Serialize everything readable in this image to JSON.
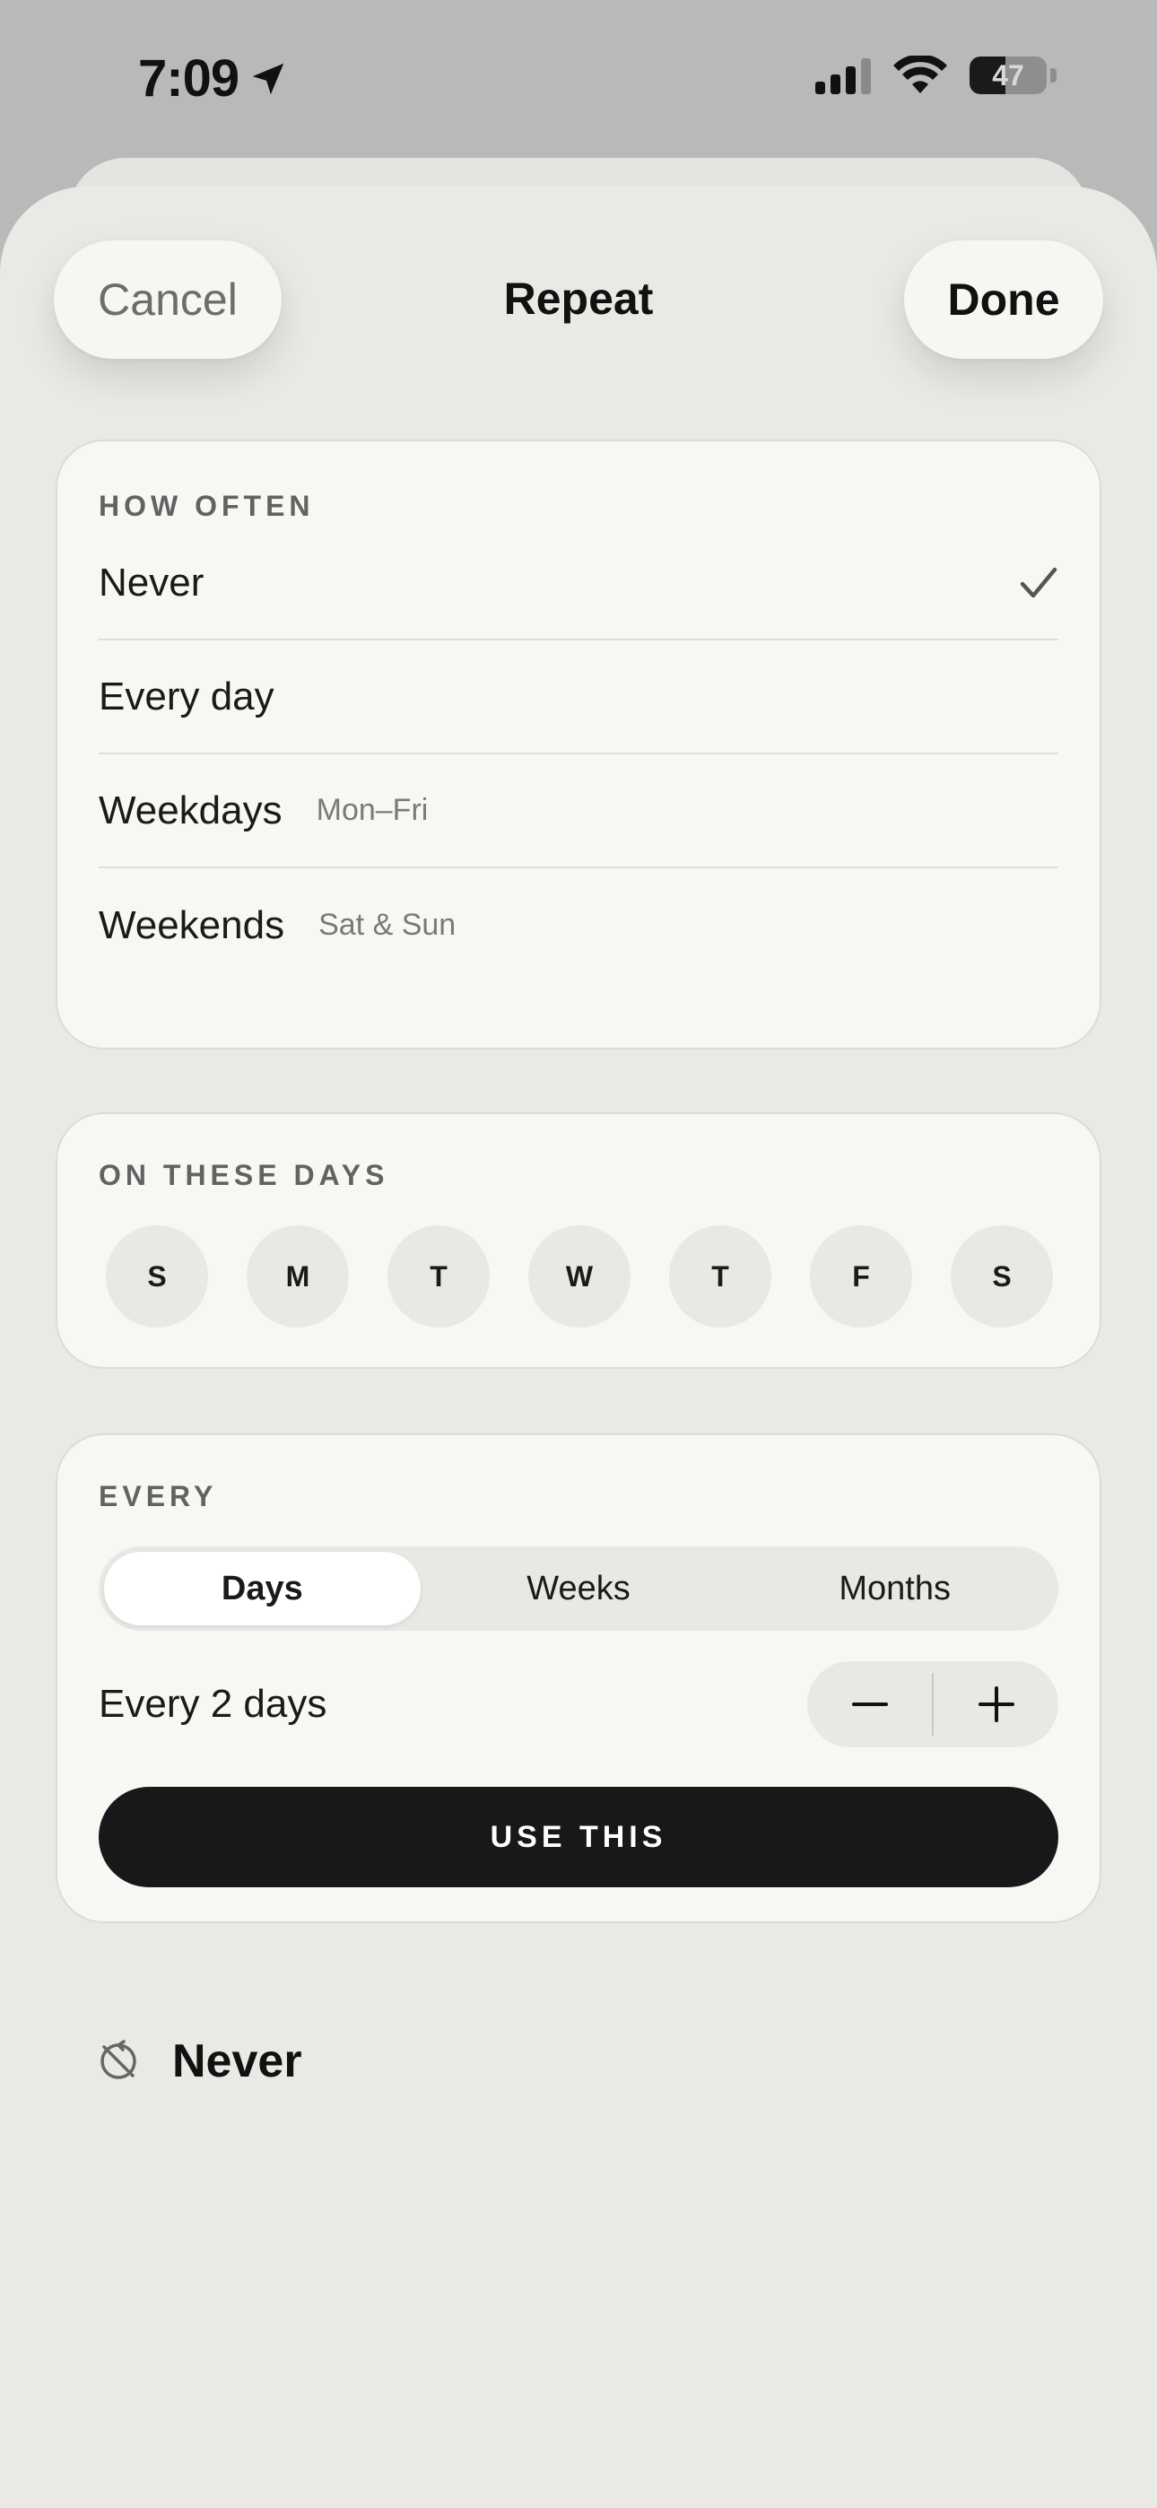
{
  "status_bar": {
    "time": "7:09",
    "battery": "47",
    "battery_level": 0.47,
    "icons": [
      "location-arrow-icon",
      "cellular-signal-icon",
      "wifi-icon",
      "battery-icon"
    ]
  },
  "header": {
    "cancel_label": "Cancel",
    "title": "Repeat",
    "done_label": "Done"
  },
  "how_often": {
    "label": "HOW OFTEN",
    "options": [
      {
        "label": "Never",
        "sub": "",
        "selected": true
      },
      {
        "label": "Every day",
        "sub": "",
        "selected": false
      },
      {
        "label": "Weekdays",
        "sub": "Mon–Fri",
        "selected": false
      },
      {
        "label": "Weekends",
        "sub": "Sat & Sun",
        "selected": false
      }
    ]
  },
  "on_these_days": {
    "label": "ON THESE DAYS",
    "days": [
      "S",
      "M",
      "T",
      "W",
      "T",
      "F",
      "S"
    ]
  },
  "every": {
    "label": "EVERY",
    "segments": [
      "Days",
      "Weeks",
      "Months"
    ],
    "selected_segment": "Days",
    "interval_label": "Every 2 days",
    "use_button_label": "USE THIS"
  },
  "summary": {
    "icon": "repeat-off-icon",
    "text": "Never"
  },
  "colors": {
    "sheet_bg": "#e9e9e5",
    "card_bg": "#f7f7f3",
    "primary_button": "#17181a"
  }
}
